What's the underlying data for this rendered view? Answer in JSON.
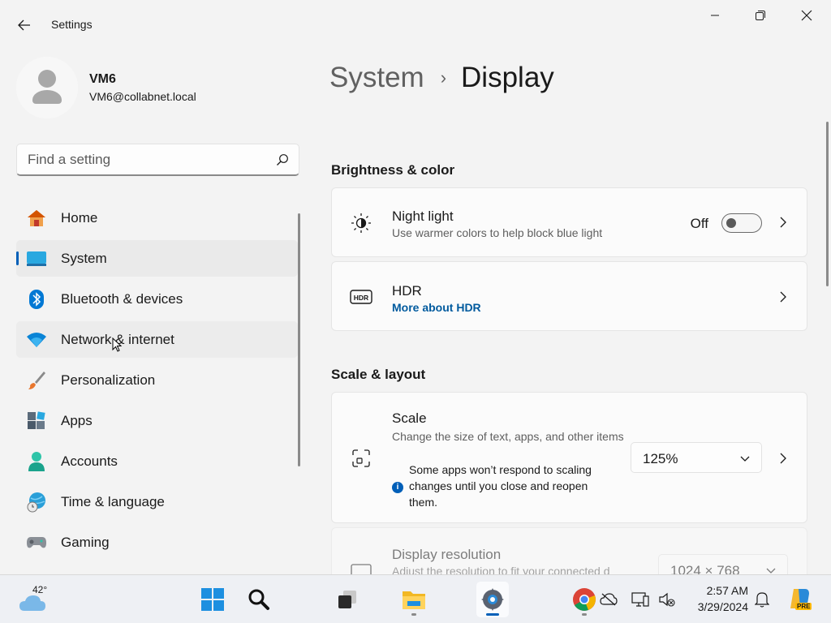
{
  "app": {
    "title": "Settings"
  },
  "profile": {
    "name": "VM6",
    "email": "VM6@collabnet.local"
  },
  "search": {
    "placeholder": "Find a setting"
  },
  "nav": {
    "items": [
      {
        "label": "Home",
        "icon": "home-icon"
      },
      {
        "label": "System",
        "icon": "system-icon",
        "selected": true
      },
      {
        "label": "Bluetooth & devices",
        "icon": "bluetooth-icon"
      },
      {
        "label": "Network & internet",
        "icon": "wifi-icon",
        "hovered": true
      },
      {
        "label": "Personalization",
        "icon": "brush-icon"
      },
      {
        "label": "Apps",
        "icon": "apps-icon"
      },
      {
        "label": "Accounts",
        "icon": "accounts-icon"
      },
      {
        "label": "Time & language",
        "icon": "globe-clock-icon"
      },
      {
        "label": "Gaming",
        "icon": "gamepad-icon"
      }
    ]
  },
  "breadcrumb": {
    "parent": "System",
    "separator": "›",
    "current": "Display"
  },
  "sections": {
    "brightness": {
      "header": "Brightness & color",
      "night_light": {
        "title": "Night light",
        "subtitle": "Use warmer colors to help block blue light",
        "state_label": "Off",
        "on": false
      },
      "hdr": {
        "title": "HDR",
        "link": "More about HDR"
      }
    },
    "scale_layout": {
      "header": "Scale & layout",
      "scale": {
        "title": "Scale",
        "subtitle": "Change the size of text, apps, and other items",
        "note": "Some apps won’t respond to scaling changes until you close and reopen them.",
        "value": "125%"
      },
      "resolution": {
        "title": "Display resolution",
        "subtitle": "Adjust the resolution to fit your connected d",
        "value": "1024 × 768"
      }
    }
  },
  "taskbar": {
    "weather_temp": "42°",
    "time": "2:57 AM",
    "date": "3/29/2024",
    "pre_badge": "PRE"
  },
  "colors": {
    "accent": "#005fb8",
    "link": "#005a9e"
  }
}
